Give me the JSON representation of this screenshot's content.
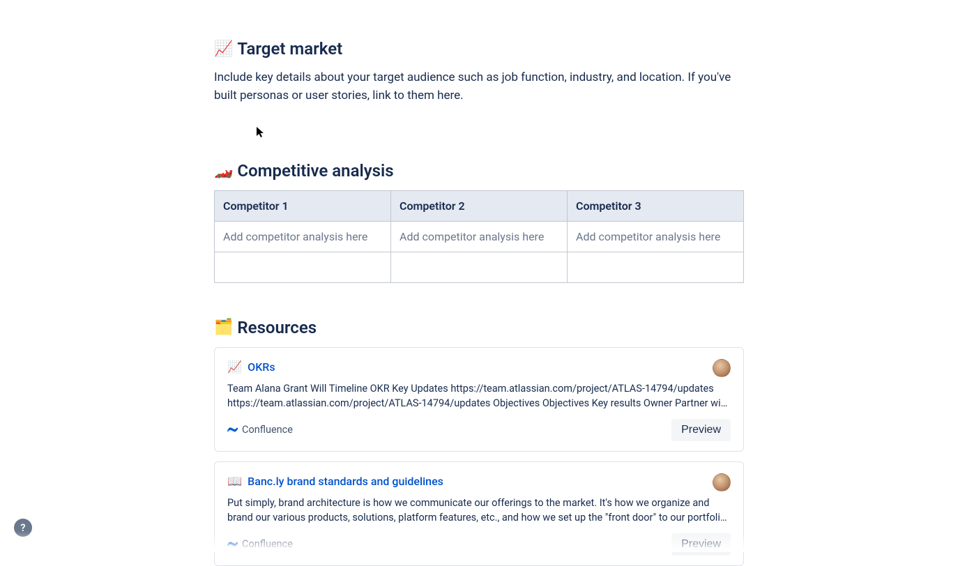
{
  "sections": {
    "target_market": {
      "emoji": "📈",
      "title": "Target market",
      "body": "Include key details about your target audience such as job function, industry, and location. If you've built personas or user stories, link to them here."
    },
    "competitive_analysis": {
      "emoji": "🏎️",
      "title": "Competitive analysis",
      "table": {
        "headers": [
          "Competitor 1",
          "Competitor 2",
          "Competitor 3"
        ],
        "rows": [
          [
            "Add competitor analysis here",
            "Add competitor analysis here",
            "Add competitor analysis here"
          ],
          [
            "",
            "",
            ""
          ]
        ]
      }
    },
    "resources": {
      "emoji": "🗂️",
      "title": "Resources",
      "cards": [
        {
          "emoji": "📈",
          "title": "OKRs",
          "body": "Team Alana Grant Will Timeline OKR Key Updates https://team.atlassian.com/project/ATLAS-14794/updates https://team.atlassian.com/project/ATLAS-14794/updates Objectives Objectives Key results Owner Partner with Expected EoQ…",
          "source": "Confluence",
          "preview_label": "Preview"
        },
        {
          "emoji": "📖",
          "title": "Banc.ly brand standards and guidelines",
          "body": "Put simply, brand architecture is how we communicate our offerings to the market. It's how we organize and brand our various products, solutions, platform features, etc., and how we set up the \"front door\" to our portfolio. Our new brand architecture…",
          "source": "Confluence",
          "preview_label": "Preview"
        }
      ]
    }
  },
  "help_label": "?"
}
